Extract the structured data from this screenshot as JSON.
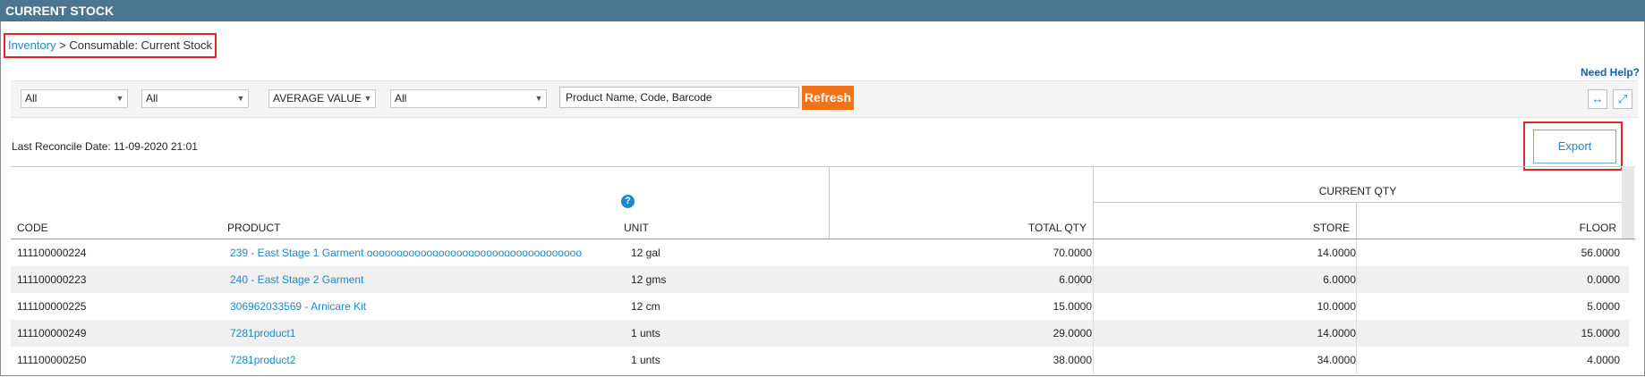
{
  "title": "CURRENT STOCK",
  "breadcrumb": {
    "link": "Inventory",
    "separator": ">",
    "current": "Consumable: Current Stock"
  },
  "help_link": "Need Help?",
  "filters": {
    "sel1": "All",
    "sel2": "All",
    "value_type": "AVERAGE VALUE",
    "sel3": "All",
    "search_value": "Product Name, Code, Barcode",
    "refresh_label": "Refresh"
  },
  "icons": {
    "fit": "fit-width-icon",
    "expand": "fullscreen-icon",
    "help": "question-icon"
  },
  "colors": {
    "header_bg": "#4a7691",
    "accent": "#1e88c8",
    "refresh_bg": "#f47216",
    "highlight": "#e0262b"
  },
  "reconcile": "Last Reconcile Date: 11-09-2020 21:01",
  "export_label": "Export",
  "table": {
    "headers": {
      "code": "CODE",
      "product": "PRODUCT",
      "unit": "UNIT",
      "total_qty": "TOTAL QTY",
      "current_qty": "CURRENT QTY",
      "store": "STORE",
      "floor": "FLOOR"
    },
    "rows": [
      {
        "code": "111100000224",
        "product": "239 - East Stage 1 Garment oooooooooooooooooooooooooooooooooooo",
        "unit": "12 gal",
        "total": "70.0000",
        "store": "14.0000",
        "floor": "56.0000"
      },
      {
        "code": "111100000223",
        "product": "240 - East Stage 2 Garment",
        "unit": "12 gms",
        "total": "6.0000",
        "store": "6.0000",
        "floor": "0.0000"
      },
      {
        "code": "111100000225",
        "product": "306962033569 - Arnicare Kit",
        "unit": "12 cm",
        "total": "15.0000",
        "store": "10.0000",
        "floor": "5.0000"
      },
      {
        "code": "111100000249",
        "product": "7281product1",
        "unit": "1 unts",
        "total": "29.0000",
        "store": "14.0000",
        "floor": "15.0000"
      },
      {
        "code": "111100000250",
        "product": "7281product2",
        "unit": "1 unts",
        "total": "38.0000",
        "store": "34.0000",
        "floor": "4.0000"
      }
    ]
  }
}
